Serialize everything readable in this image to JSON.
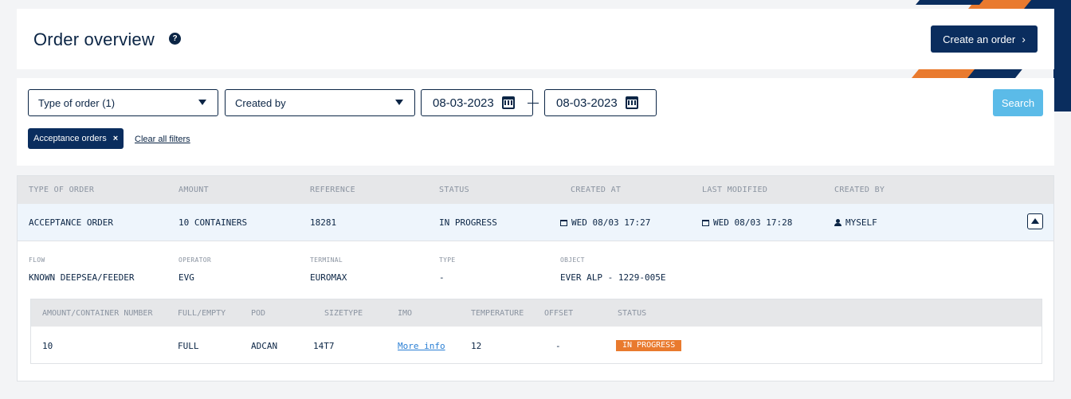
{
  "header": {
    "title": "Order overview",
    "help_icon": "?",
    "create_button": "Create an order",
    "create_chevron": "›"
  },
  "filters": {
    "type_of_order": "Type of order (1)",
    "created_by": "Created by",
    "date_from": "08-03-2023",
    "date_to": "08-03-2023",
    "search_button": "Search",
    "active_chip": "Acceptance orders",
    "chip_close": "×",
    "clear_all": "Clear all filters"
  },
  "table": {
    "columns": [
      "TYPE OF ORDER",
      "AMOUNT",
      "REFERENCE",
      "STATUS",
      "CREATED AT",
      "LAST MODIFIED",
      "CREATED BY"
    ],
    "rows": [
      {
        "type_of_order": "ACCEPTANCE ORDER",
        "amount": "10 CONTAINERS",
        "reference": "18281",
        "status": "IN PROGRESS",
        "created_at": "WED 08/03 17:27",
        "last_modified": "WED 08/03 17:28",
        "created_by": "MYSELF"
      }
    ]
  },
  "details": {
    "flow_label": "FLOW",
    "flow_value": "KNOWN DEEPSEA/FEEDER",
    "operator_label": "OPERATOR",
    "operator_value": "EVG",
    "terminal_label": "TERMINAL",
    "terminal_value": "EUROMAX",
    "type_label": "TYPE",
    "type_value": "-",
    "object_label": "OBJECT",
    "object_value": "EVER ALP - 1229-005E"
  },
  "containers": {
    "columns": [
      "AMOUNT/CONTAINER NUMBER",
      "FULL/EMPTY",
      "POD",
      "SIZETYPE",
      "IMO",
      "TEMPERATURE",
      "OFFSET",
      "STATUS"
    ],
    "rows": [
      {
        "amount": "10",
        "full_empty": "FULL",
        "pod": "ADCAN",
        "sizetype": "14T7",
        "imo": "More info",
        "temperature": "12",
        "offset": "-",
        "status": "IN PROGRESS"
      }
    ]
  },
  "colors": {
    "navy": "#0a2d5e",
    "accent_orange": "#e97a2e",
    "search_blue": "#5bbbe8"
  }
}
